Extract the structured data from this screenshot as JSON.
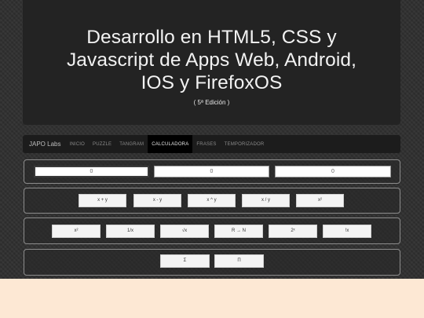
{
  "header": {
    "title_line1": "Desarrollo en HTML5, CSS y",
    "title_line2": "Javascript de Apps Web, Android,",
    "title_line3": "IOS y FirefoxOS",
    "edition": "( 5ª Edición )"
  },
  "nav": {
    "brand": "JAPO Labs",
    "tabs": [
      {
        "label": "INICIO"
      },
      {
        "label": "PUZZLE"
      },
      {
        "label": "TANGRAM"
      },
      {
        "label": "CALCULADORA"
      },
      {
        "label": "FRASES"
      },
      {
        "label": "TEMPORIZADOR"
      }
    ],
    "active_tab": "CALCULADORA"
  },
  "calculator": {
    "input1": "0",
    "input2": "0",
    "result": "0",
    "ops_binary": [
      "x + y",
      "x - y",
      "x ^ y",
      "x / y",
      "x²"
    ],
    "ops_unary": [
      "x²",
      "1/x",
      "√x",
      "R → N",
      "2ˣ",
      "!x"
    ],
    "ops_series": [
      "Σ",
      "Π"
    ]
  },
  "colors": {
    "background": "#2f2f2f",
    "header_bg": "#232323",
    "nav_bg": "#1c1c1c",
    "active_tab_bg": "#000000",
    "footer_bg": "#fde8d4"
  }
}
